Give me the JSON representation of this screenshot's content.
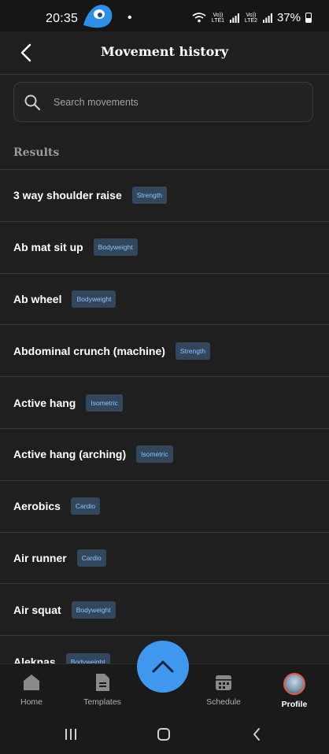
{
  "status_bar": {
    "time": "20:35",
    "battery": "37%",
    "sim1": "Vo)) LTE1",
    "sim2": "Vo)) LTE2"
  },
  "header": {
    "title": "Movement history"
  },
  "search": {
    "placeholder": "Search movements",
    "value": ""
  },
  "section_label": "Results",
  "movements": [
    {
      "name": "3 way shoulder raise",
      "tag": "Strength"
    },
    {
      "name": "Ab mat sit up",
      "tag": "Bodyweight"
    },
    {
      "name": "Ab wheel",
      "tag": "Bodyweight"
    },
    {
      "name": "Abdominal crunch (machine)",
      "tag": "Strength"
    },
    {
      "name": "Active hang",
      "tag": "Isometric"
    },
    {
      "name": "Active hang (arching)",
      "tag": "Isometric"
    },
    {
      "name": "Aerobics",
      "tag": "Cardio"
    },
    {
      "name": "Air runner",
      "tag": "Cardio"
    },
    {
      "name": "Air squat",
      "tag": "Bodyweight"
    },
    {
      "name": "Aleknas",
      "tag": "Bodyweight"
    }
  ],
  "bottom_nav": {
    "home": "Home",
    "templates": "Templates",
    "schedule": "Schedule",
    "profile": "Profile"
  },
  "colors": {
    "accent": "#3f97ee",
    "tag_bg": "#33475c",
    "tag_text": "#8fc1ff",
    "background": "#1f1f1f"
  }
}
